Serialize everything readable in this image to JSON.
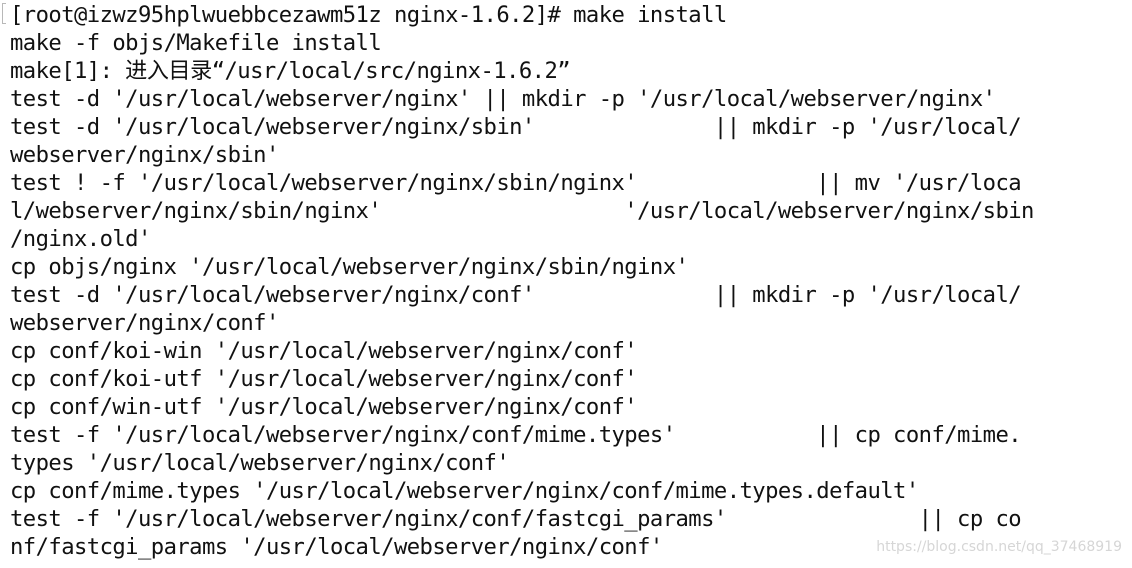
{
  "terminal": {
    "lines": [
      "[root@izwz95hplwuebbcezawm51z nginx-1.6.2]# make install",
      "make -f objs/Makefile install",
      "make[1]: 进入目录“/usr/local/src/nginx-1.6.2”",
      "test -d '/usr/local/webserver/nginx' || mkdir -p '/usr/local/webserver/nginx'",
      "test -d '/usr/local/webserver/nginx/sbin'              || mkdir -p '/usr/local/",
      "webserver/nginx/sbin'",
      "test ! -f '/usr/local/webserver/nginx/sbin/nginx'              || mv '/usr/loca",
      "l/webserver/nginx/sbin/nginx'                   '/usr/local/webserver/nginx/sbin",
      "/nginx.old'",
      "cp objs/nginx '/usr/local/webserver/nginx/sbin/nginx'",
      "test -d '/usr/local/webserver/nginx/conf'              || mkdir -p '/usr/local/",
      "webserver/nginx/conf'",
      "cp conf/koi-win '/usr/local/webserver/nginx/conf'",
      "cp conf/koi-utf '/usr/local/webserver/nginx/conf'",
      "cp conf/win-utf '/usr/local/webserver/nginx/conf'",
      "test -f '/usr/local/webserver/nginx/conf/mime.types'           || cp conf/mime.",
      "types '/usr/local/webserver/nginx/conf'",
      "cp conf/mime.types '/usr/local/webserver/nginx/conf/mime.types.default'",
      "test -f '/usr/local/webserver/nginx/conf/fastcgi_params'               || cp co",
      "nf/fastcgi_params '/usr/local/webserver/nginx/conf'"
    ]
  },
  "watermark": "https://blog.csdn.net/qq_37468919"
}
